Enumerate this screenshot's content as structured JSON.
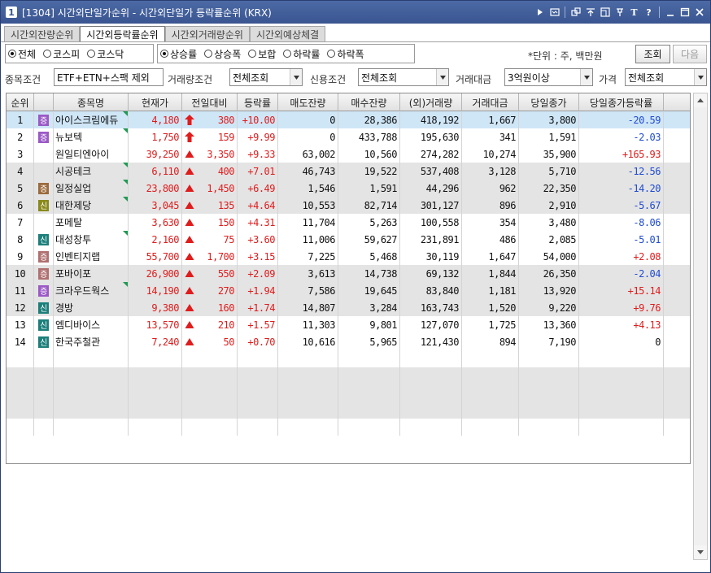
{
  "window": {
    "number": "1",
    "title": "[1304] 시간외단일가순위 - 시간외단일가 등락률순위 (KRX)",
    "icons": [
      "play-icon",
      "screen-icon",
      "link-icon",
      "pin-top-icon",
      "pin-icon",
      "font-icon",
      "help-icon",
      "minimize-icon",
      "maximize-icon",
      "close-icon"
    ]
  },
  "tabs": [
    {
      "label": "시간외잔량순위",
      "active": false
    },
    {
      "label": "시간외등락률순위",
      "active": true
    },
    {
      "label": "시간외거래량순위",
      "active": false
    },
    {
      "label": "시간외예상체결",
      "active": false
    }
  ],
  "market_options": [
    {
      "label": "전체",
      "checked": true
    },
    {
      "label": "코스피",
      "checked": false
    },
    {
      "label": "코스닥",
      "checked": false
    }
  ],
  "sort_options": [
    {
      "label": "상승률",
      "checked": true
    },
    {
      "label": "상승폭",
      "checked": false
    },
    {
      "label": "보합",
      "checked": false
    },
    {
      "label": "하락률",
      "checked": false
    },
    {
      "label": "하락폭",
      "checked": false
    }
  ],
  "unit_text": "*단위 : 주, 백만원",
  "buttons": {
    "search": "조회",
    "next": "다음"
  },
  "filters": [
    {
      "label": "종목조건",
      "value": "ETF+ETN+스팩 제외"
    },
    {
      "label": "거래량조건",
      "value": "전체조회"
    },
    {
      "label": "신용조건",
      "value": "전체조회"
    },
    {
      "label": "거래대금",
      "value": "3억원이상"
    },
    {
      "label": "가격",
      "value": "전체조회"
    }
  ],
  "columns": [
    "순위",
    "",
    "종목명",
    "현재가",
    "전일대비",
    "등락률",
    "매도잔량",
    "매수잔량",
    "(외)거래량",
    "거래대금",
    "당일종가",
    "당일종가등락률"
  ],
  "colors": {
    "rise": "#e01c1c",
    "fall": "#1f4bd0",
    "selected_row": "#cfe6f7",
    "band_row": "#e4e4e4",
    "badge_purple": "#9b59c6",
    "badge_brown": "#9c6b3c",
    "badge_teal": "#1c7f7b"
  },
  "rows": [
    {
      "rank": "1",
      "badge": "증",
      "badge_color": "#9b59c6",
      "name": "아이스크림에듀",
      "flag": true,
      "price": "4,180",
      "arrow": "up-limit",
      "change": "380",
      "rate": "+10.00",
      "ask": "0",
      "bid": "28,386",
      "volume": "418,192",
      "amount": "1,667",
      "close": "3,800",
      "close_rate": "-20.59",
      "close_dir": "fall"
    },
    {
      "rank": "2",
      "badge": "증",
      "badge_color": "#9b59c6",
      "name": "뉴보텍",
      "flag": true,
      "price": "1,750",
      "arrow": "up-limit",
      "change": "159",
      "rate": "+9.99",
      "ask": "0",
      "bid": "433,788",
      "volume": "195,630",
      "amount": "341",
      "close": "1,591",
      "close_rate": "-2.03",
      "close_dir": "fall"
    },
    {
      "rank": "3",
      "badge": "",
      "badge_color": "",
      "name": "원일티엔아이",
      "flag": false,
      "price": "39,250",
      "arrow": "up",
      "change": "3,350",
      "rate": "+9.33",
      "ask": "63,002",
      "bid": "10,560",
      "volume": "274,282",
      "amount": "10,274",
      "close": "35,900",
      "close_rate": "+165.93",
      "close_dir": "rise"
    },
    {
      "rank": "4",
      "badge": "",
      "badge_color": "",
      "name": "시공테크",
      "flag": true,
      "price": "6,110",
      "arrow": "up",
      "change": "400",
      "rate": "+7.01",
      "ask": "46,743",
      "bid": "19,522",
      "volume": "537,408",
      "amount": "3,128",
      "close": "5,710",
      "close_rate": "-12.56",
      "close_dir": "fall"
    },
    {
      "rank": "5",
      "badge": "증",
      "badge_color": "#9c6b3c",
      "name": "일정실업",
      "flag": true,
      "price": "23,800",
      "arrow": "up",
      "change": "1,450",
      "rate": "+6.49",
      "ask": "1,546",
      "bid": "1,591",
      "volume": "44,296",
      "amount": "962",
      "close": "22,350",
      "close_rate": "-14.20",
      "close_dir": "fall"
    },
    {
      "rank": "6",
      "badge": "신",
      "badge_color": "#8a8a1c",
      "name": "대한제당",
      "flag": true,
      "price": "3,045",
      "arrow": "up",
      "change": "135",
      "rate": "+4.64",
      "ask": "10,553",
      "bid": "82,714",
      "volume": "301,127",
      "amount": "896",
      "close": "2,910",
      "close_rate": "-5.67",
      "close_dir": "fall"
    },
    {
      "rank": "7",
      "badge": "",
      "badge_color": "",
      "name": "포메탈",
      "flag": false,
      "price": "3,630",
      "arrow": "up",
      "change": "150",
      "rate": "+4.31",
      "ask": "11,704",
      "bid": "5,263",
      "volume": "100,558",
      "amount": "354",
      "close": "3,480",
      "close_rate": "-8.06",
      "close_dir": "fall"
    },
    {
      "rank": "8",
      "badge": "신",
      "badge_color": "#1c7f7b",
      "name": "대성창투",
      "flag": true,
      "price": "2,160",
      "arrow": "up",
      "change": "75",
      "rate": "+3.60",
      "ask": "11,006",
      "bid": "59,627",
      "volume": "231,891",
      "amount": "486",
      "close": "2,085",
      "close_rate": "-5.01",
      "close_dir": "fall"
    },
    {
      "rank": "9",
      "badge": "증",
      "badge_color": "#b07070",
      "name": "인벤티지랩",
      "flag": false,
      "price": "55,700",
      "arrow": "up",
      "change": "1,700",
      "rate": "+3.15",
      "ask": "7,225",
      "bid": "5,468",
      "volume": "30,119",
      "amount": "1,647",
      "close": "54,000",
      "close_rate": "+2.08",
      "close_dir": "rise"
    },
    {
      "rank": "10",
      "badge": "증",
      "badge_color": "#b07070",
      "name": "포바이포",
      "flag": false,
      "price": "26,900",
      "arrow": "up",
      "change": "550",
      "rate": "+2.09",
      "ask": "3,613",
      "bid": "14,738",
      "volume": "69,132",
      "amount": "1,844",
      "close": "26,350",
      "close_rate": "-2.04",
      "close_dir": "fall"
    },
    {
      "rank": "11",
      "badge": "증",
      "badge_color": "#9b59c6",
      "name": "크라우드웍스",
      "flag": true,
      "price": "14,190",
      "arrow": "up",
      "change": "270",
      "rate": "+1.94",
      "ask": "7,586",
      "bid": "19,645",
      "volume": "83,840",
      "amount": "1,181",
      "close": "13,920",
      "close_rate": "+15.14",
      "close_dir": "rise"
    },
    {
      "rank": "12",
      "badge": "신",
      "badge_color": "#1c7f7b",
      "name": "경방",
      "flag": false,
      "price": "9,380",
      "arrow": "up",
      "change": "160",
      "rate": "+1.74",
      "ask": "14,807",
      "bid": "3,284",
      "volume": "163,743",
      "amount": "1,520",
      "close": "9,220",
      "close_rate": "+9.76",
      "close_dir": "rise"
    },
    {
      "rank": "13",
      "badge": "신",
      "badge_color": "#1c7f7b",
      "name": "엠디바이스",
      "flag": false,
      "price": "13,570",
      "arrow": "up",
      "change": "210",
      "rate": "+1.57",
      "ask": "11,303",
      "bid": "9,801",
      "volume": "127,070",
      "amount": "1,725",
      "close": "13,360",
      "close_rate": "+4.13",
      "close_dir": "rise"
    },
    {
      "rank": "14",
      "badge": "신",
      "badge_color": "#1c7f7b",
      "name": "한국주철관",
      "flag": false,
      "price": "7,240",
      "arrow": "up",
      "change": "50",
      "rate": "+0.70",
      "ask": "10,616",
      "bid": "5,965",
      "volume": "121,430",
      "amount": "894",
      "close": "7,190",
      "close_rate": "0",
      "close_dir": "flat"
    }
  ]
}
